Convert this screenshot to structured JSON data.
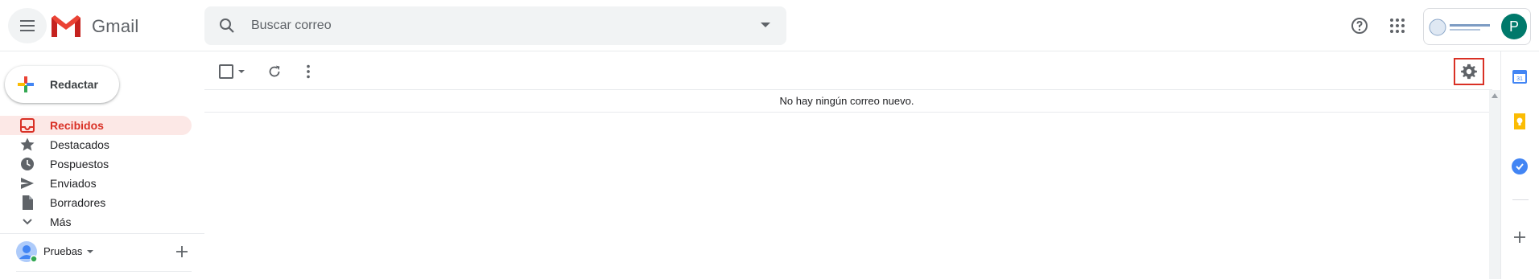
{
  "header": {
    "app_name": "Gmail",
    "search_placeholder": "Buscar correo",
    "avatar_initial": "P"
  },
  "sidebar": {
    "compose_label": "Redactar",
    "items": [
      {
        "label": "Recibidos",
        "icon": "inbox-icon",
        "active": true
      },
      {
        "label": "Destacados",
        "icon": "star-icon"
      },
      {
        "label": "Pospuestos",
        "icon": "clock-icon"
      },
      {
        "label": "Enviados",
        "icon": "send-icon"
      },
      {
        "label": "Borradores",
        "icon": "draft-icon"
      },
      {
        "label": "Más",
        "icon": "chevron-down-icon"
      }
    ],
    "hangouts_user": "Pruebas"
  },
  "main": {
    "empty_message": "No hay ningún correo nuevo."
  },
  "colors": {
    "active_red": "#d93025",
    "active_bg": "#fce8e6",
    "search_bg": "#f1f3f4",
    "avatar_bg": "#00796b"
  }
}
